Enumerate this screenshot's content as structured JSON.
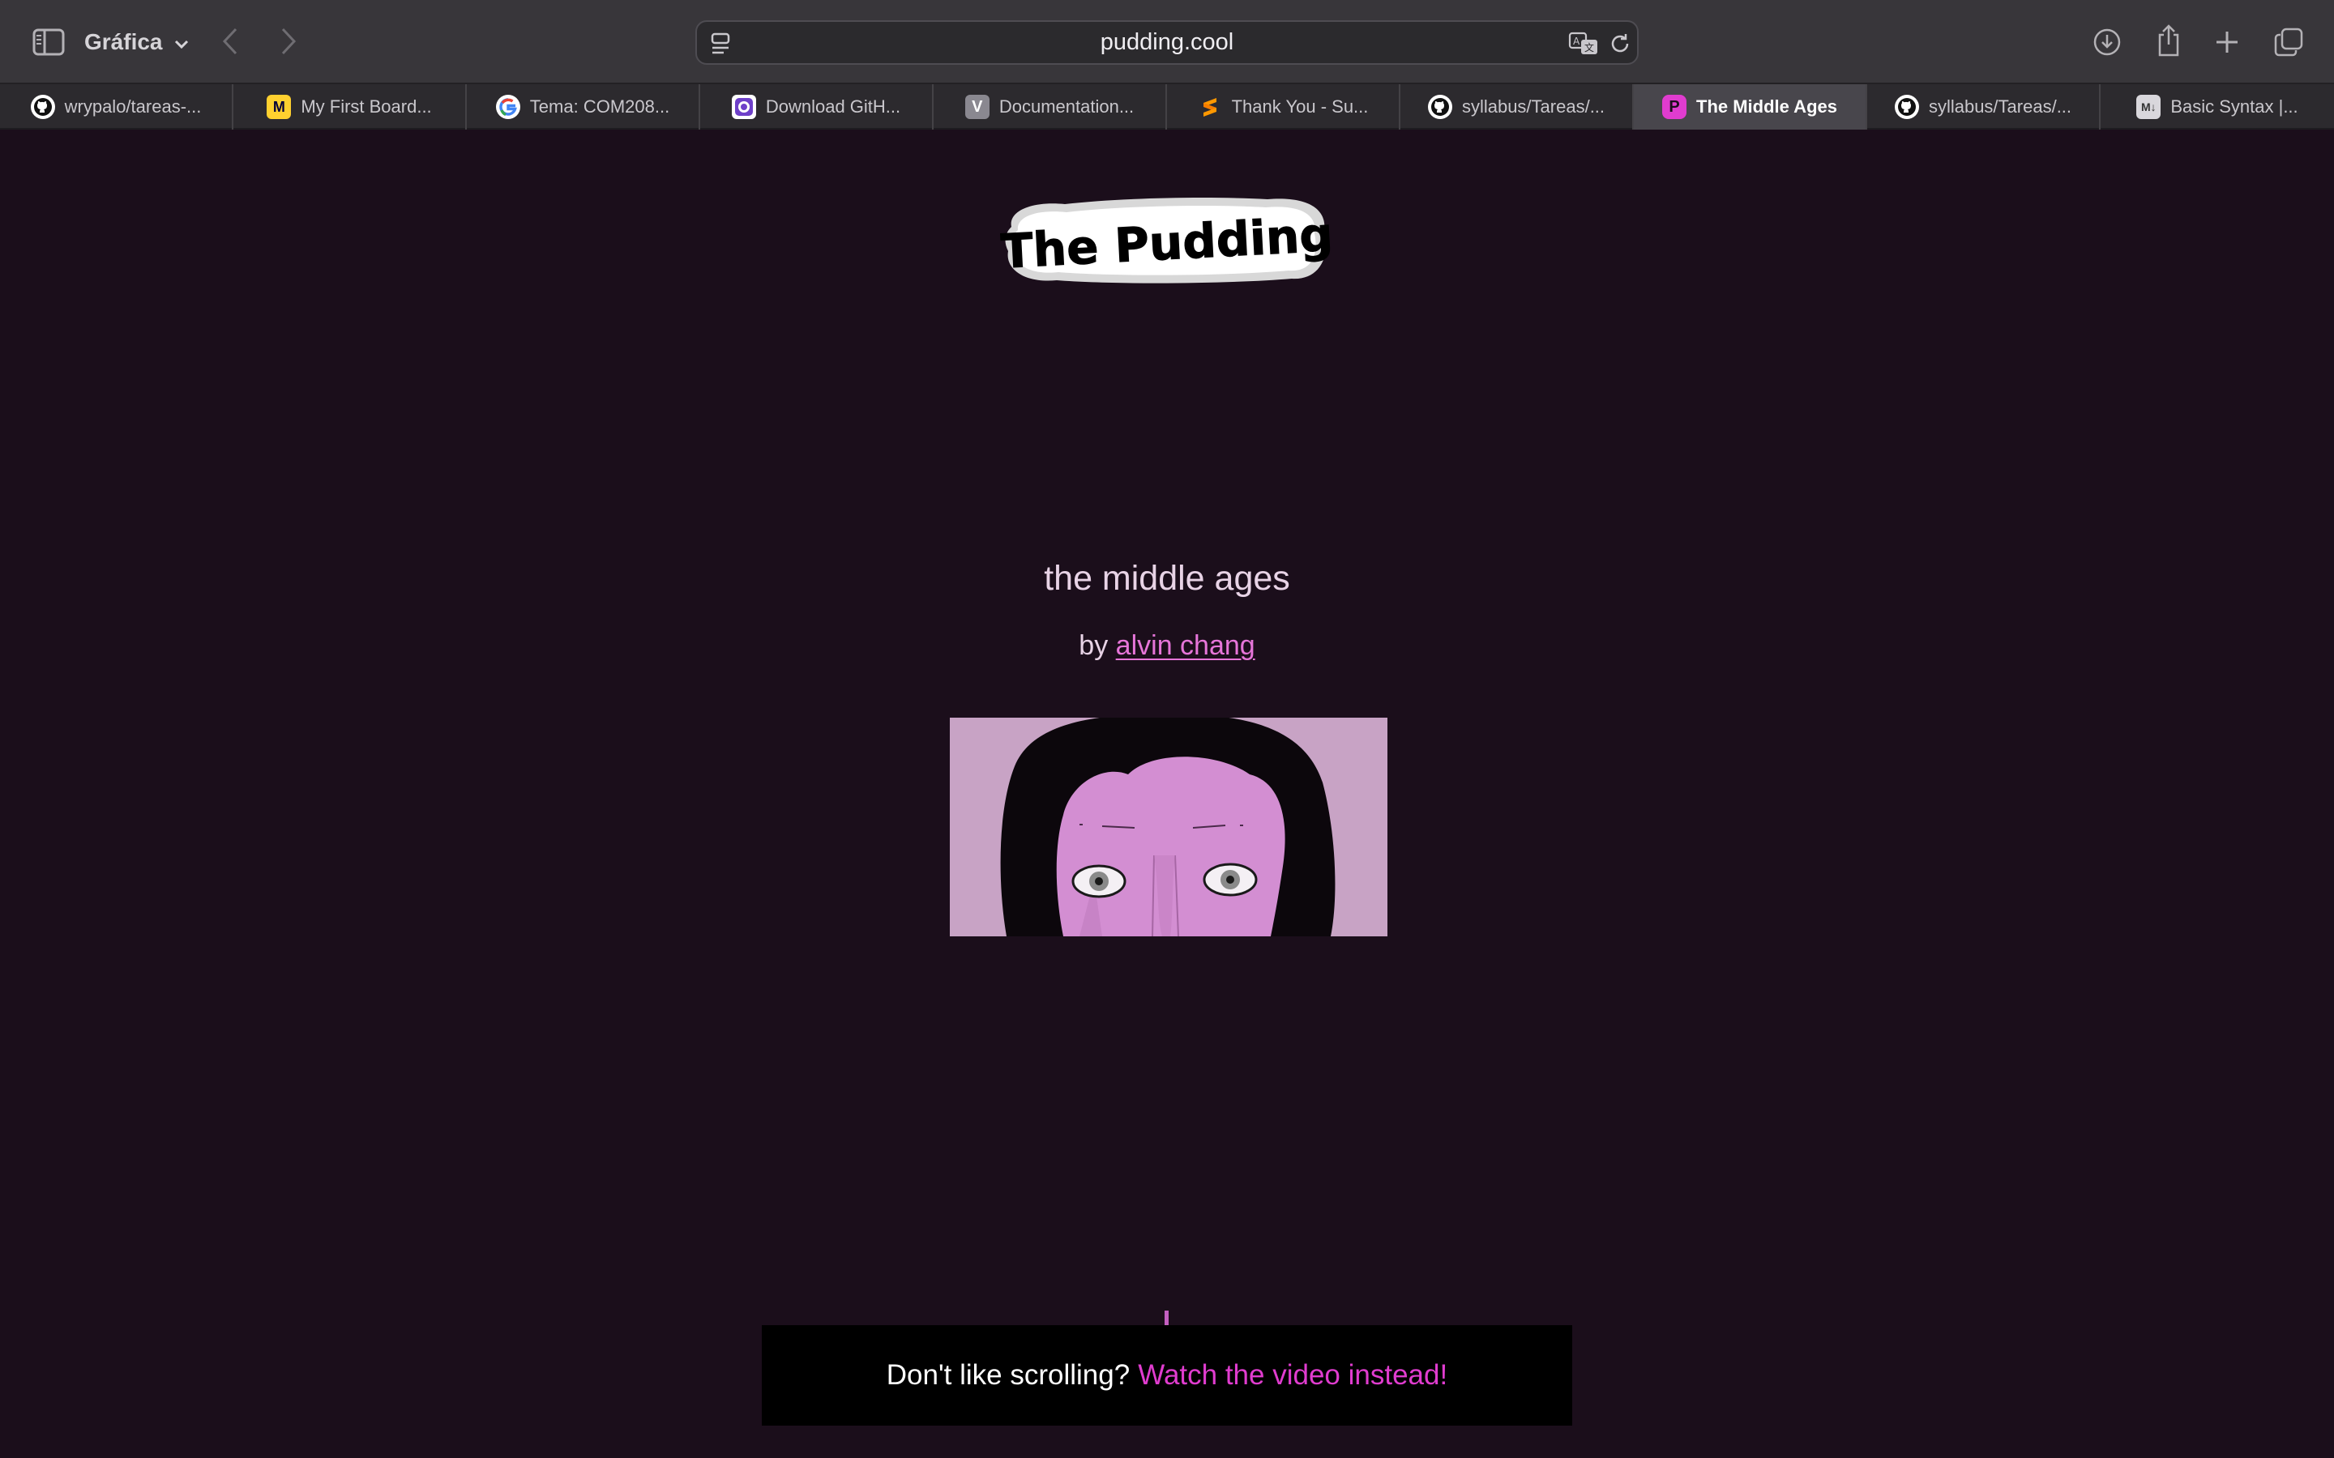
{
  "toolbar": {
    "tab_group_label": "Gráfica",
    "url": "pudding.cool"
  },
  "tabs": [
    {
      "label": "wrypalo/tareas-...",
      "favicon": "github-icon",
      "active": false
    },
    {
      "label": "My First Board...",
      "favicon": "miro-icon",
      "active": false
    },
    {
      "label": "Tema: COM208...",
      "favicon": "google-icon",
      "active": false
    },
    {
      "label": "Download GitH...",
      "favicon": "github-desktop-icon",
      "active": false
    },
    {
      "label": "Documentation...",
      "favicon": "v-icon",
      "active": false
    },
    {
      "label": "Thank You - Su...",
      "favicon": "sublime-icon",
      "active": false
    },
    {
      "label": "syllabus/Tareas/...",
      "favicon": "github-icon",
      "active": false
    },
    {
      "label": "The Middle Ages",
      "favicon": "pudding-icon",
      "active": true
    },
    {
      "label": "syllabus/Tareas/...",
      "favicon": "github-icon",
      "active": false
    },
    {
      "label": "Basic Syntax |...",
      "favicon": "markdown-icon",
      "active": false
    }
  ],
  "page": {
    "logo_text": "The Pudding",
    "title": "the middle ages",
    "byline_prefix": "by",
    "author": "alvin chang",
    "banner_text": "Don't like scrolling?",
    "banner_link": "Watch the video instead!"
  },
  "colors": {
    "page_background": "#1b0e1b",
    "accent_pink": "#e03ccf",
    "link_pink": "#e675d9",
    "title_text": "#e8d3e6"
  }
}
